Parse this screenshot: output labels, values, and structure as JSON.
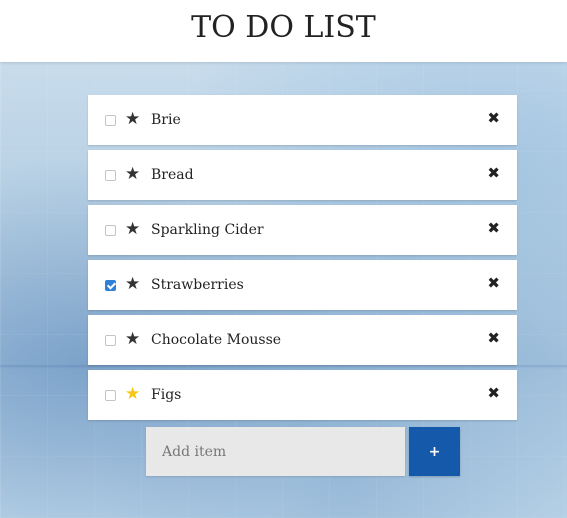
{
  "header": {
    "title": "TO DO LIST"
  },
  "items": [
    {
      "label": "Brie",
      "checked": false,
      "starred": false
    },
    {
      "label": "Bread",
      "checked": false,
      "starred": false
    },
    {
      "label": "Sparkling Cider",
      "checked": false,
      "starred": false
    },
    {
      "label": "Strawberries",
      "checked": true,
      "starred": false
    },
    {
      "label": "Chocolate Mousse",
      "checked": false,
      "starred": false
    },
    {
      "label": "Figs",
      "checked": false,
      "starred": true
    }
  ],
  "icons": {
    "star": "★",
    "delete": "✖",
    "add": "+"
  },
  "add_form": {
    "placeholder": "Add item",
    "value": ""
  },
  "colors": {
    "star_active": "#f7c716",
    "checkbox_checked": "#2f80d8",
    "add_button": "#1559ab"
  }
}
